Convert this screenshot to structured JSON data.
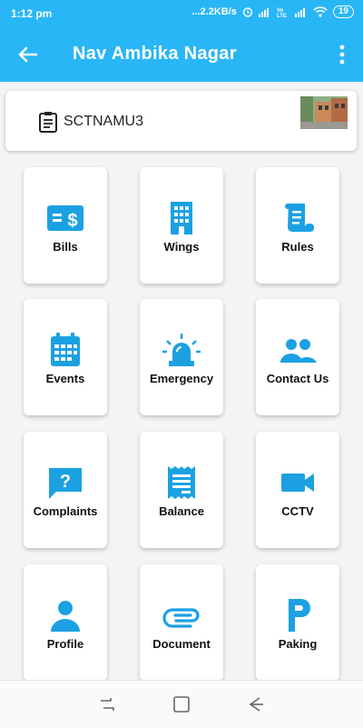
{
  "status_bar": {
    "time": "1:12 pm",
    "network_speed": "...2.2KB/s",
    "battery": "19"
  },
  "app_bar": {
    "title": "Nav Ambika Nagar",
    "back_icon": "arrow-left-icon",
    "menu_icon": "more-vertical-icon"
  },
  "society": {
    "code": "SCTNAMU3",
    "icon": "clipboard-icon"
  },
  "accent_color": "#29b6f6",
  "tiles": [
    {
      "label": "Bills",
      "icon": "bill-dollar-icon"
    },
    {
      "label": "Wings",
      "icon": "building-icon"
    },
    {
      "label": "Rules",
      "icon": "scroll-icon"
    },
    {
      "label": "Events",
      "icon": "calendar-icon"
    },
    {
      "label": "Emergency",
      "icon": "siren-icon"
    },
    {
      "label": "Contact Us",
      "icon": "people-icon"
    },
    {
      "label": "Complaints",
      "icon": "question-chat-icon"
    },
    {
      "label": "Balance",
      "icon": "receipt-icon"
    },
    {
      "label": "CCTV",
      "icon": "video-camera-icon"
    },
    {
      "label": "Profile",
      "icon": "person-icon"
    },
    {
      "label": "Document",
      "icon": "paperclip-icon"
    },
    {
      "label": "Paking",
      "icon": "parking-icon"
    }
  ]
}
